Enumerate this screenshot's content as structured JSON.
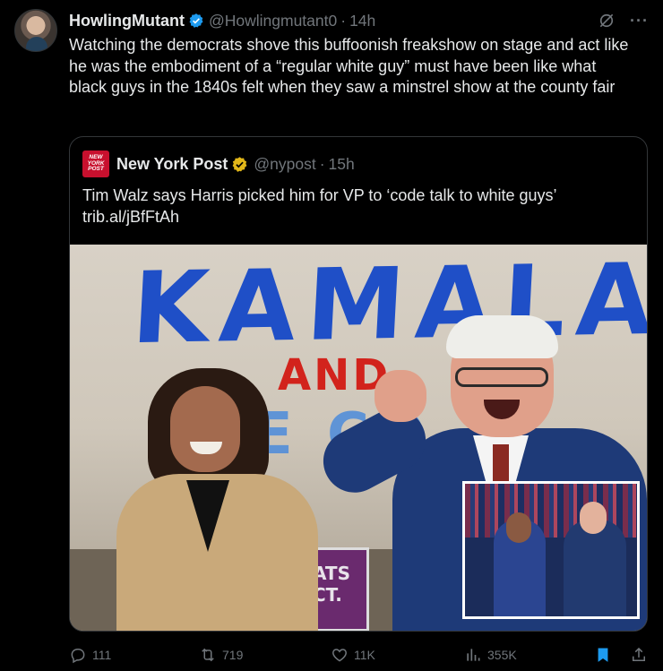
{
  "tweet": {
    "display_name": "HowlingMutant",
    "handle": "@Howlingmutant0",
    "separator": "·",
    "time": "14h",
    "more": "···",
    "text": "Watching the democrats shove this buffoonish freakshow on stage and act like he was the embodiment of a “regular white guy” must have been like what black guys in the 1840s felt when they saw a minstrel show at the county fair"
  },
  "quote": {
    "logo_text": "NEW YORK POST",
    "display_name": "New York Post",
    "handle": "@nypost",
    "separator": "·",
    "time": "15h",
    "text_line1": "Tim Walz says Harris picked him for VP to ‘code talk to white guys’",
    "text_line2": "trib.al/jBfFtAh",
    "photo": {
      "banner_word": "KAMALA",
      "banner_and": "AND",
      "banner_fragment": "E CO",
      "sign_text_1": "ATS",
      "sign_text_2": "CT."
    }
  },
  "actions": {
    "replies": "111",
    "reposts": "719",
    "likes": "11K",
    "views": "355K"
  },
  "colors": {
    "background": "#000000",
    "text": "#e7e9ea",
    "muted": "#71767b",
    "verified_blue": "#1d9bf0",
    "gold_badge": "#e2b719",
    "bookmark_active": "#1d9bf0",
    "nypost_red": "#c8102e"
  },
  "icons": [
    "verified-badge-icon",
    "grok-icon",
    "more-icon",
    "gold-verified-badge-icon",
    "reply-icon",
    "repost-icon",
    "like-icon",
    "views-icon",
    "bookmark-icon",
    "share-icon"
  ]
}
